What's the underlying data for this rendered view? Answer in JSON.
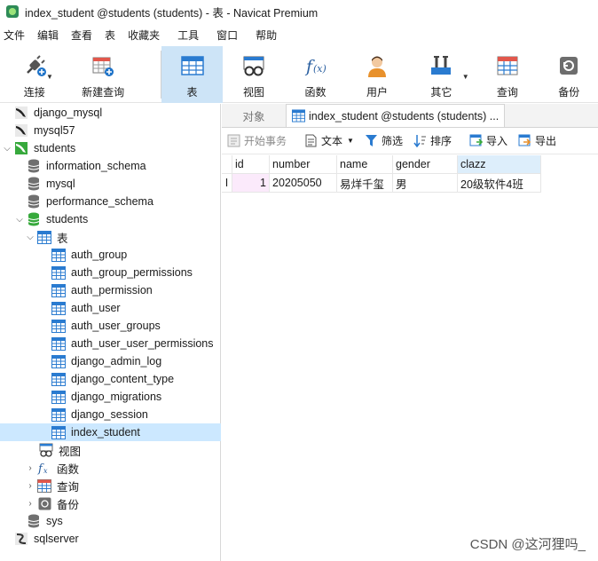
{
  "window": {
    "title": "index_student @students (students) - 表 - Navicat Premium"
  },
  "menu": [
    "文件",
    "编辑",
    "查看",
    "表",
    "收藏夹",
    "工具",
    "窗口",
    "帮助"
  ],
  "toolbar": {
    "connect": "连接",
    "new_query": "新建查询",
    "table": "表",
    "view": "视图",
    "function": "函数",
    "user": "用户",
    "other": "其它",
    "query": "查询",
    "backup": "备份"
  },
  "tree": {
    "django_mysql": "django_mysql",
    "mysql57": "mysql57",
    "students_conn": "students",
    "information_schema": "information_schema",
    "mysql": "mysql",
    "performance_schema": "performance_schema",
    "students_db": "students",
    "tables_folder": "表",
    "tables": [
      "auth_group",
      "auth_group_permissions",
      "auth_permission",
      "auth_user",
      "auth_user_groups",
      "auth_user_user_permissions",
      "django_admin_log",
      "django_content_type",
      "django_migrations",
      "django_session",
      "index_student"
    ],
    "views": "视图",
    "functions": "函数",
    "queries": "查询",
    "backups": "备份",
    "sys": "sys",
    "sqlserver": "sqlserver"
  },
  "tabs": {
    "objects": "对象",
    "active": "index_student @students (students) ..."
  },
  "grid_toolbar": {
    "begin_transaction": "开始事务",
    "text": "文本",
    "filter": "筛选",
    "sort": "排序",
    "import": "导入",
    "export": "导出"
  },
  "grid": {
    "columns": [
      "id",
      "number",
      "name",
      "gender",
      "clazz"
    ],
    "rows": [
      [
        "1",
        "20205050",
        "易烊千玺",
        "男",
        "20级软件4班"
      ]
    ],
    "row_marker": "I"
  },
  "watermark": "CSDN @这河狸吗_",
  "colors": {
    "accent": "#cde4f7",
    "selection": "#cce8ff",
    "green": "#37a93c",
    "db_gray": "#707070"
  }
}
